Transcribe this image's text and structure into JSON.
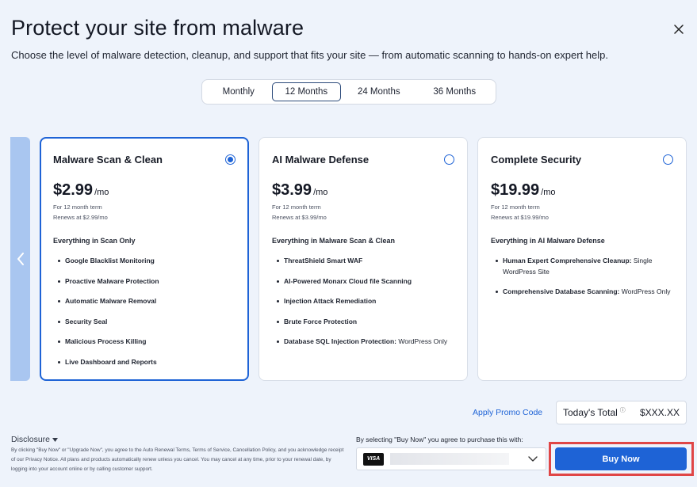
{
  "header": {
    "title": "Protect your site from malware",
    "subtitle": "Choose the level of malware detection, cleanup, and support that fits your site — from automatic scanning to hands-on expert help.",
    "close_icon": "close-icon"
  },
  "billing_tabs": [
    {
      "label": "Monthly",
      "active": false
    },
    {
      "label": "12 Months",
      "active": true
    },
    {
      "label": "24 Months",
      "active": false
    },
    {
      "label": "36 Months",
      "active": false
    }
  ],
  "plans": [
    {
      "name": "Malware Scan & Clean",
      "selected": true,
      "price": "$2.99",
      "per": "/mo",
      "term": "For 12 month term",
      "renews": "Renews at $2.99/mo",
      "everything": "Everything in Scan Only",
      "features": [
        {
          "bold": "Google Blacklist Monitoring",
          "rest": ""
        },
        {
          "bold": "Proactive Malware Protection",
          "rest": ""
        },
        {
          "bold": "Automatic Malware Removal",
          "rest": ""
        },
        {
          "bold": "Security Seal",
          "rest": ""
        },
        {
          "bold": "Malicious Process Killing",
          "rest": ""
        },
        {
          "bold": "Live Dashboard and Reports",
          "rest": ""
        }
      ]
    },
    {
      "name": "AI Malware Defense",
      "selected": false,
      "price": "$3.99",
      "per": "/mo",
      "term": "For 12 month term",
      "renews": "Renews at $3.99/mo",
      "everything": "Everything in Malware Scan & Clean",
      "features": [
        {
          "bold": "ThreatShield Smart WAF",
          "rest": ""
        },
        {
          "bold": "AI-Powered Monarx Cloud file Scanning",
          "rest": ""
        },
        {
          "bold": "Injection Attack Remediation",
          "rest": ""
        },
        {
          "bold": "Brute Force Protection",
          "rest": ""
        },
        {
          "bold": "Database SQL Injection Protection:",
          "rest": " WordPress Only"
        }
      ]
    },
    {
      "name": "Complete Security",
      "selected": false,
      "price": "$19.99",
      "per": "/mo",
      "term": "For 12 month term",
      "renews": "Renews at $19.99/mo",
      "everything": "Everything in AI Malware Defense",
      "features": [
        {
          "bold": "Human Expert Comprehensive Cleanup:",
          "rest": " Single WordPress Site"
        },
        {
          "bold": "Comprehensive Database Scanning:",
          "rest": " WordPress Only"
        }
      ]
    }
  ],
  "summary": {
    "promo_label": "Apply Promo Code",
    "total_label": "Today's Total",
    "total_info": "ⓘ",
    "total_value": "$XXX.XX"
  },
  "disclosure": {
    "label": "Disclosure",
    "text": "By clicking \"Buy Now\" or \"Upgrade Now\", you agree to the Auto Renewal Terms, Terms of Service, Cancellation Policy, and you acknowledge receipt of our Privacy Notice. All plans and products automatically renew unless you cancel. You may cancel at any time, prior to your renewal date, by logging into your account online or by calling customer support."
  },
  "payment": {
    "note": "By selecting \"Buy Now\" you agree to purchase this with:",
    "card_brand": "VISA",
    "buy_label": "Buy Now"
  },
  "colors": {
    "accent": "#1e63d6",
    "highlight": "#e04646",
    "background": "#eef3fb"
  }
}
